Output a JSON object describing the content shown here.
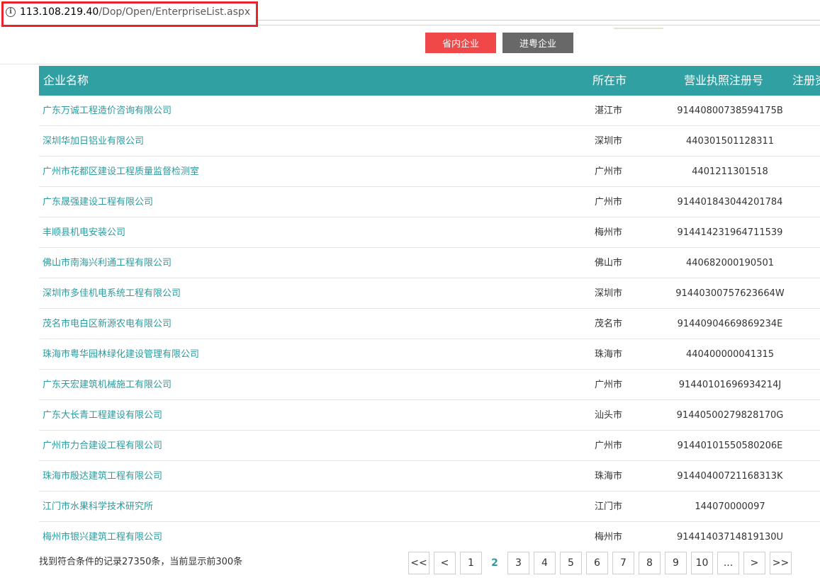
{
  "browser": {
    "url_host": "113.108.219.40",
    "url_path": "/Dop/Open/EnterpriseList.aspx"
  },
  "tabs": {
    "province": "省内企业",
    "outside": "进粤企业"
  },
  "table": {
    "headers": {
      "name": "企业名称",
      "city": "所在市",
      "license": "营业执照注册号",
      "reg": "注册资"
    },
    "rows": [
      {
        "name": "广东万诚工程造价咨询有限公司",
        "city": "湛江市",
        "license": "91440800738594175B"
      },
      {
        "name": "深圳华加日铝业有限公司",
        "city": "深圳市",
        "license": "440301501128311"
      },
      {
        "name": "广州市花都区建设工程质量监督检测室",
        "city": "广州市",
        "license": "4401211301518"
      },
      {
        "name": "广东晟强建设工程有限公司",
        "city": "广州市",
        "license": "914401843044201784"
      },
      {
        "name": "丰顺县机电安装公司",
        "city": "梅州市",
        "license": "914414231964711539"
      },
      {
        "name": "佛山市南海兴利通工程有限公司",
        "city": "佛山市",
        "license": "440682000190501"
      },
      {
        "name": "深圳市多佳机电系统工程有限公司",
        "city": "深圳市",
        "license": "91440300757623664W"
      },
      {
        "name": "茂名市电白区新源农电有限公司",
        "city": "茂名市",
        "license": "91440904669869234E"
      },
      {
        "name": "珠海市粤华园林绿化建设管理有限公司",
        "city": "珠海市",
        "license": "440400000041315"
      },
      {
        "name": "广东天宏建筑机械施工有限公司",
        "city": "广州市",
        "license": "91440101696934214J"
      },
      {
        "name": "广东大长青工程建设有限公司",
        "city": "汕头市",
        "license": "91440500279828170G"
      },
      {
        "name": "广州市力合建设工程有限公司",
        "city": "广州市",
        "license": "91440101550580206E"
      },
      {
        "name": "珠海市殷达建筑工程有限公司",
        "city": "珠海市",
        "license": "91440400721168313K"
      },
      {
        "name": "江门市水果科学技术研究所",
        "city": "江门市",
        "license": "144070000097"
      },
      {
        "name": "梅州市银兴建筑工程有限公司",
        "city": "梅州市",
        "license": "91441403714819130U"
      }
    ]
  },
  "footer": {
    "summary": "找到符合条件的记录27350条，当前显示前300条",
    "pager": {
      "first": "<<",
      "prev": "<",
      "pages": [
        "1",
        "2",
        "3",
        "4",
        "5",
        "6",
        "7",
        "8",
        "9",
        "10"
      ],
      "current": "2",
      "ellipsis": "...",
      "next": ">",
      "last": ">>"
    }
  }
}
